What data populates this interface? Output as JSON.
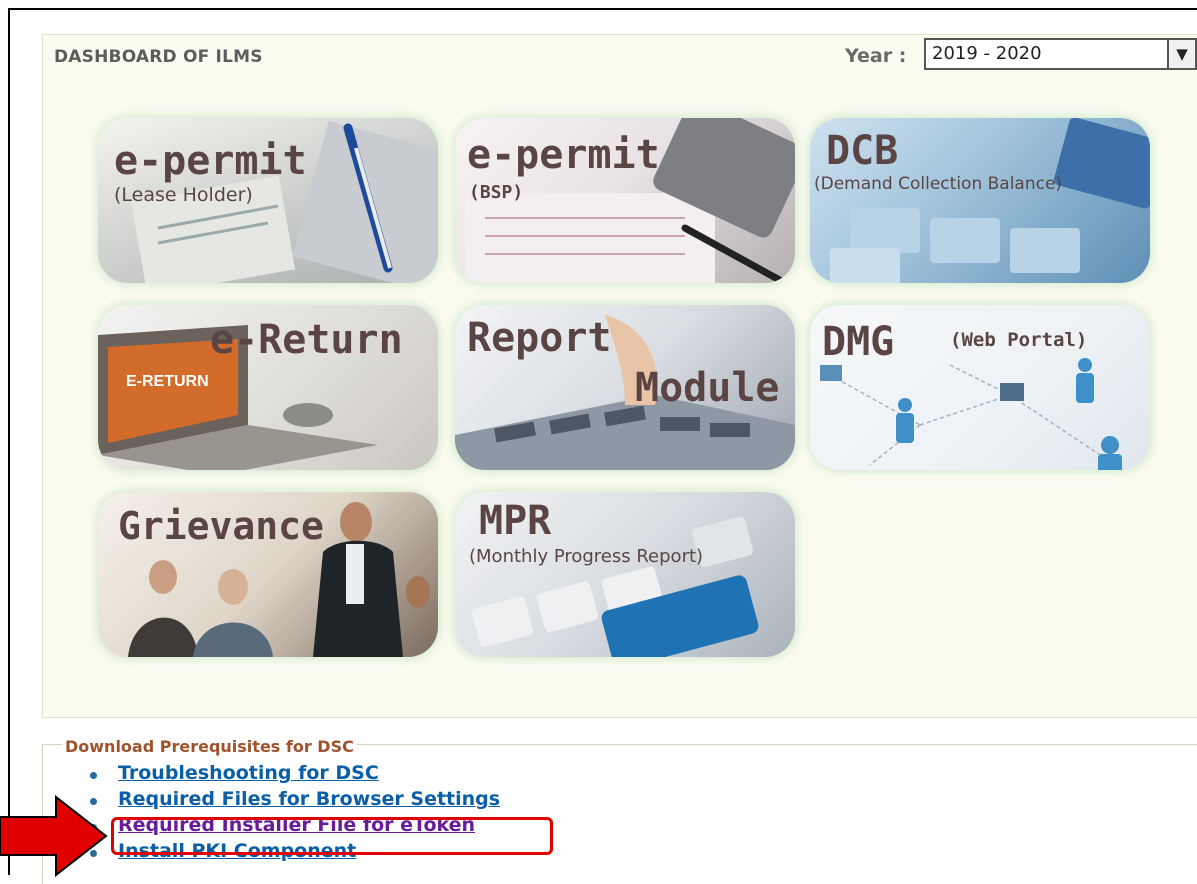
{
  "dashboard": {
    "title": "DASHBOARD OF ILMS",
    "year_label": "Year :",
    "year_value": "2019 - 2020"
  },
  "tiles": [
    {
      "name": "e-permit",
      "subtitle": "(Lease Holder)"
    },
    {
      "name": "e-permit",
      "subtitle": "(BSP)"
    },
    {
      "name": "DCB",
      "subtitle": "(Demand Collection Balance)"
    },
    {
      "name": "e-Return",
      "badge": "E-RETURN"
    },
    {
      "name": "Report",
      "subtitle": "Module"
    },
    {
      "name": "DMG",
      "subtitle": "(Web Portal)"
    },
    {
      "name": "Grievance"
    },
    {
      "name": "MPR",
      "subtitle": "(Monthly Progress Report)"
    }
  ],
  "prerequisites": {
    "legend": "Download Prerequisites for DSC",
    "links": [
      "Troubleshooting for DSC",
      "Required Files for Browser Settings",
      "Required Installer File for eToken",
      "Install PKI Component"
    ]
  },
  "colors": {
    "tile_text": "#5a4544",
    "link": "#0b5fa8",
    "visited_link": "#6a1b9a",
    "legend": "#a0522d",
    "highlight": "#e00000",
    "arrow": "#e00000"
  }
}
